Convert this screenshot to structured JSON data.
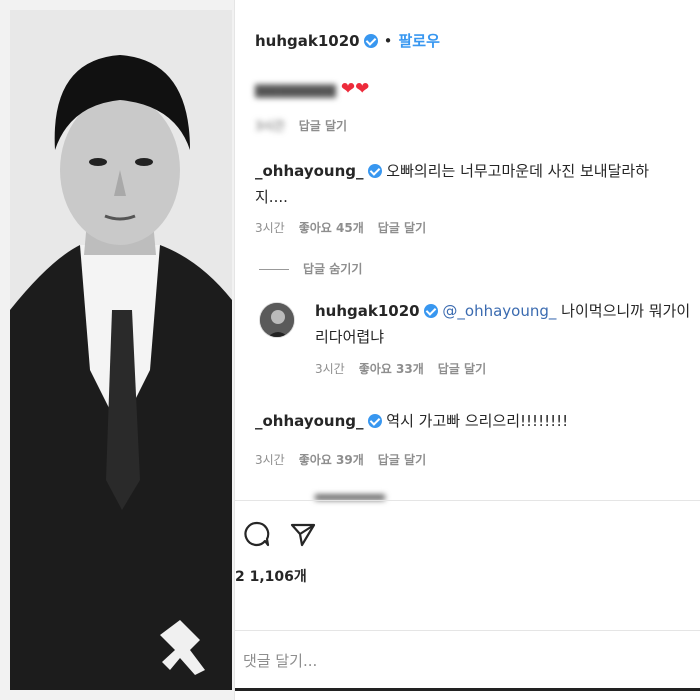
{
  "post": {
    "author": "huhgak1020",
    "separator": "•",
    "follow_label": "팔로우"
  },
  "comments": [
    {
      "user": "",
      "text": "",
      "time": "",
      "likes": "",
      "reply": "답글 달기"
    },
    {
      "user": "_ohhayoung_",
      "text_line1": "오빠의리는 너무고마운데 사진 보내달라하",
      "text_line2": "지....",
      "time": "3시간",
      "likes": "좋아요 45개",
      "reply": "답글 달기",
      "hide_replies": "답글 숨기기"
    },
    {
      "user": "huhgak1020",
      "mention": "@_ohhayoung_",
      "text_line1": "나이먹으니까 뭐가이",
      "text_line2": "리다어렵냐",
      "time": "3시간",
      "likes": "좋아요 33개",
      "reply": "답글 달기"
    },
    {
      "user": "_ohhayoung_",
      "text": "역시 가고빠 으리으리!!!!!!!!",
      "time": "3시간",
      "likes": "좋아요 39개",
      "reply": "답글 달기"
    }
  ],
  "footer": {
    "likes_count": "1,106개",
    "likes_prefix": "2",
    "comment_placeholder": "댓글 달기..."
  },
  "colors": {
    "accent": "#3897f0",
    "heart": "#ed2b3b",
    "muted": "#8e8e8e"
  }
}
